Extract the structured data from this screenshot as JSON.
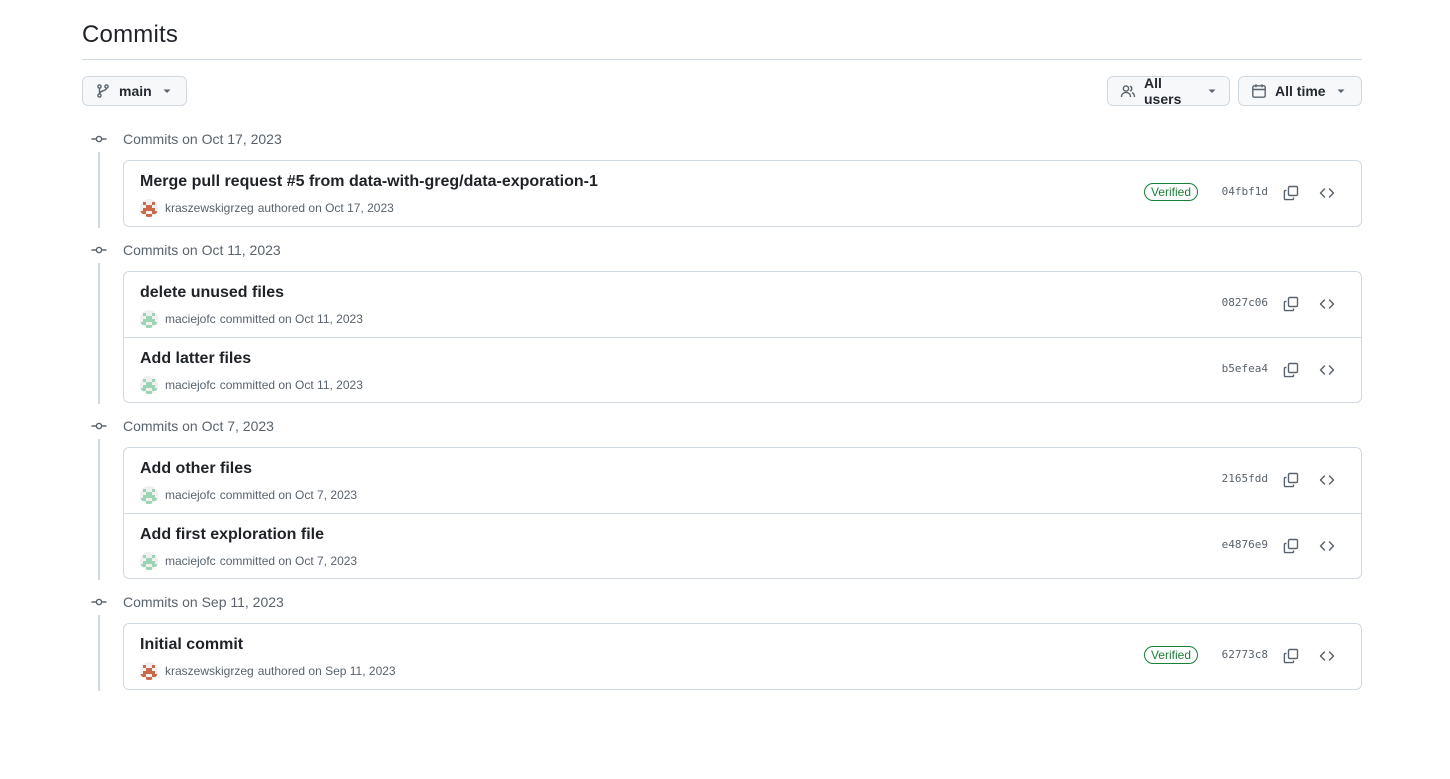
{
  "page": {
    "title": "Commits"
  },
  "toolbar": {
    "branch_label": "main",
    "users_label": "All users",
    "time_label": "All time"
  },
  "groups": [
    {
      "heading": "Commits on Oct 17, 2023",
      "commits": [
        {
          "message": "Merge pull request #5 from data-with-greg/data-exporation-1",
          "author": "kraszewskigrzeg",
          "action": "authored on Oct 17, 2023",
          "verified": "Verified",
          "sha": "04fbf1d",
          "avatar": "pixel-orange"
        }
      ]
    },
    {
      "heading": "Commits on Oct 11, 2023",
      "commits": [
        {
          "message": "delete unused files",
          "author": "maciejofc",
          "action": "committed on Oct 11, 2023",
          "verified": "",
          "sha": "0827c06",
          "avatar": "pixel-green"
        },
        {
          "message": "Add latter files",
          "author": "maciejofc",
          "action": "committed on Oct 11, 2023",
          "verified": "",
          "sha": "b5efea4",
          "avatar": "pixel-green"
        }
      ]
    },
    {
      "heading": "Commits on Oct 7, 2023",
      "commits": [
        {
          "message": "Add other files",
          "author": "maciejofc",
          "action": "committed on Oct 7, 2023",
          "verified": "",
          "sha": "2165fdd",
          "avatar": "pixel-green"
        },
        {
          "message": "Add first exploration file",
          "author": "maciejofc",
          "action": "committed on Oct 7, 2023",
          "verified": "",
          "sha": "e4876e9",
          "avatar": "pixel-green"
        }
      ]
    },
    {
      "heading": "Commits on Sep 11, 2023",
      "commits": [
        {
          "message": "Initial commit",
          "author": "kraszewskigrzeg",
          "action": "authored on Sep 11, 2023",
          "verified": "Verified",
          "sha": "62773c8",
          "avatar": "pixel-orange"
        }
      ]
    }
  ],
  "colors": {
    "verified": "#1a7f37",
    "border": "#d1d9e0",
    "muted_text": "#59636e",
    "avatar_orange": "#c86a4a",
    "avatar_green": "#9bd3b4"
  }
}
